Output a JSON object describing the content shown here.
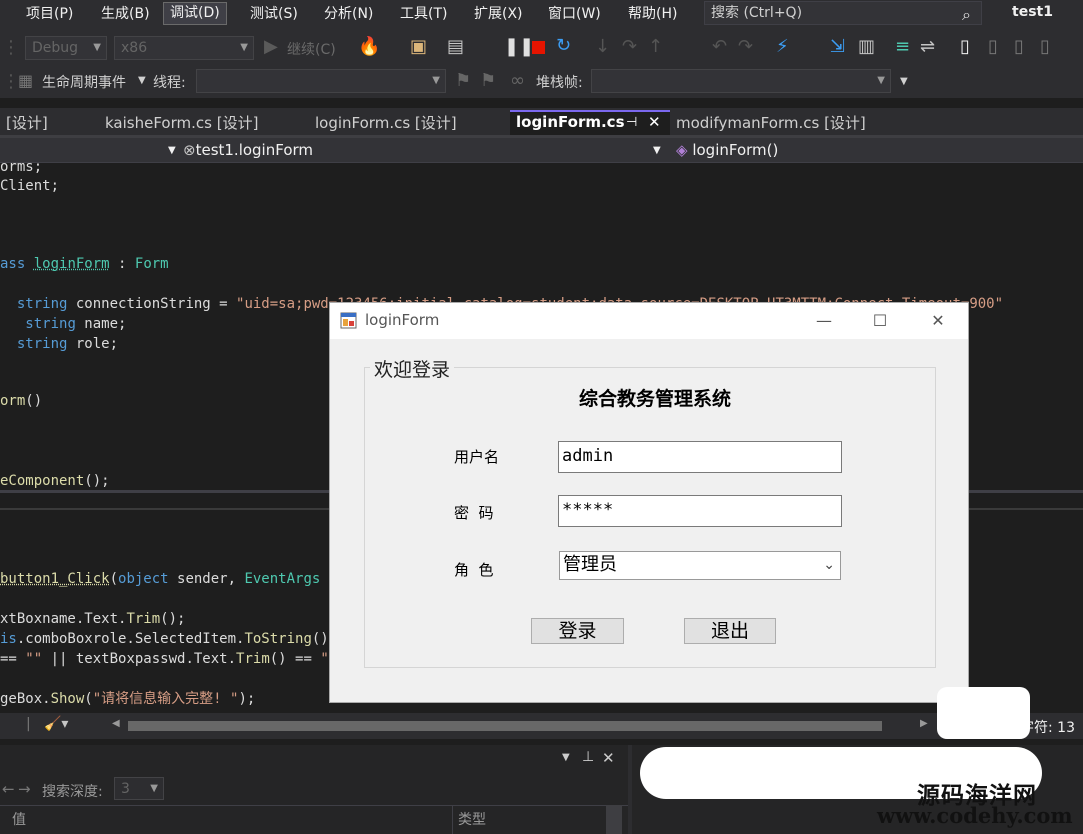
{
  "menubar": {
    "items": [
      "项目(P)",
      "生成(B)",
      "调试(D)",
      "测试(S)",
      "分析(N)",
      "工具(T)",
      "扩展(X)",
      "窗口(W)",
      "帮助(H)"
    ],
    "search_placeholder": "搜索 (Ctrl+Q)",
    "solution_name": "test1"
  },
  "toolbar1": {
    "config": "Debug",
    "platform": "x86",
    "continue_label": "继续(C)"
  },
  "toolbar2": {
    "lifecycle_label": "生命周期事件",
    "thread_label": "线程:",
    "stack_label": "堆栈帧:"
  },
  "tabs": [
    {
      "label": "[设计]"
    },
    {
      "label": "kaisheForm.cs [设计]"
    },
    {
      "label": "loginForm.cs [设计]"
    },
    {
      "label": "loginForm.cs"
    },
    {
      "label": "modifymanForm.cs [设计]"
    }
  ],
  "navbar": {
    "class_name": "test1.loginForm",
    "member_name": "loginForm()"
  },
  "status": {
    "char_label": "字符: 13"
  },
  "bottom": {
    "search_depth_label": "搜索深度:",
    "search_depth_value": "3",
    "col_value": "值",
    "col_type": "类型"
  },
  "dialog": {
    "title": "loginForm",
    "group_title": "欢迎登录",
    "system_title": "综合教务管理系统",
    "username_label": "用户名",
    "username_value": "admin",
    "password_label": "密  码",
    "password_value": "*****",
    "role_label": "角  色",
    "role_value": "管理员",
    "login_button": "登录",
    "exit_button": "退出"
  },
  "watermark": {
    "line1": "源码海洋网",
    "line2": "www.codehy.com"
  }
}
